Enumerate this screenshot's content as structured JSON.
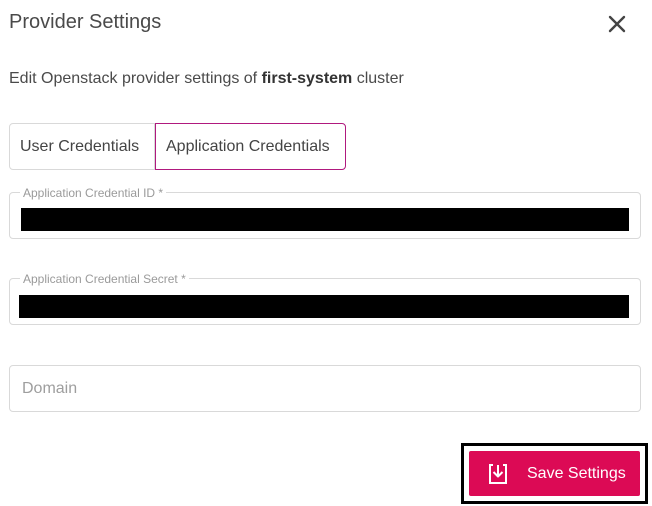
{
  "dialog": {
    "title": "Provider Settings",
    "subtitle_prefix": "Edit Openstack provider settings of ",
    "cluster_name": "first-system",
    "subtitle_suffix": " cluster"
  },
  "tabs": [
    {
      "label": "User Credentials",
      "active": false
    },
    {
      "label": "Application Credentials",
      "active": true
    }
  ],
  "fields": {
    "credential_id": {
      "label": "Application Credential ID *",
      "value": "[redacted]"
    },
    "credential_secret": {
      "label": "Application Credential Secret *",
      "value": "[redacted]"
    },
    "domain": {
      "placeholder": "Domain",
      "value": ""
    }
  },
  "actions": {
    "save_label": "Save Settings"
  },
  "colors": {
    "accent": "#dc0a55",
    "tab_active_border": "#b0197e"
  },
  "icons": {
    "close": "close-icon",
    "save": "download-save-icon"
  }
}
